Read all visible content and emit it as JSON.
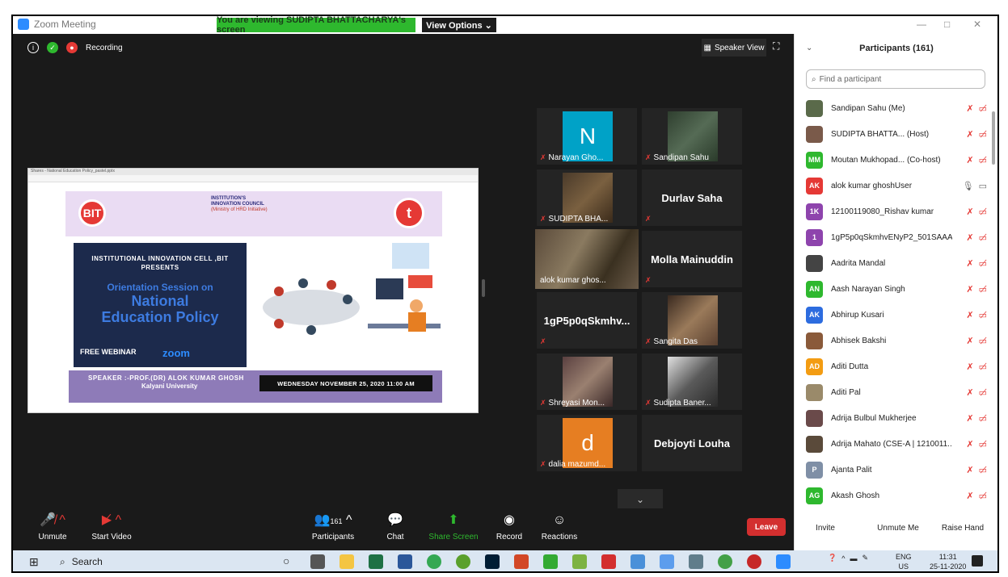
{
  "window": {
    "app_title": "Zoom Meeting",
    "viewing_banner": "You are viewing SUDIPTA BHATTACHARYA's screen",
    "view_options": "View Options ⌄",
    "minimize": "—",
    "maximize": "□",
    "close": "✕"
  },
  "meeting_top": {
    "recording_label": "Recording",
    "speaker_view_label": "Speaker View"
  },
  "shared_screen": {
    "doc_title": "Shares - National Education Policy_pastel.pptx",
    "logo_left": "BIT",
    "iic_text": "INSTITUTION'S INNOVATION COUNCIL",
    "iic_sub": "(Ministry of HRD Initiative)",
    "logo_right": "t",
    "line1": "INSTITUTIONAL INNOVATION CELL ,BIT",
    "line1b": "PRESENTS",
    "line2": "Orientation Session on",
    "line3": "National",
    "line4": "Education Policy",
    "webinar": "FREE WEBINAR",
    "zoom_logo": "zoom",
    "speaker": "SPEAKER :-PROF.(DR) ALOK KUMAR GHOSH",
    "affiliation": "Kalyani University",
    "date": "WEDNESDAY NOVEMBER 25, 2020 11:00 AM"
  },
  "tiles": [
    {
      "name": "Narayan Gho...",
      "avatar": "N",
      "color": "#00a2c7"
    },
    {
      "name": "Sandipan Sahu"
    },
    {
      "name": "SUDIPTA BHA..."
    },
    {
      "name": "Durlav Saha"
    },
    {
      "name": "alok kumar ghos..."
    },
    {
      "name": "Molla Mainuddin"
    },
    {
      "name": "1gP5p0qSkmhv..."
    },
    {
      "name": "Sangita Das"
    },
    {
      "name": "Shreyasi Mon..."
    },
    {
      "name": "Sudipta Baner..."
    },
    {
      "name": "dalia mazumd...",
      "avatar": "d",
      "color": "#e67e22"
    },
    {
      "name": "Debjoyti Louha"
    }
  ],
  "toolbar": {
    "unmute": "Unmute",
    "start_video": "Start Video",
    "participants": "Participants",
    "participants_count": "161",
    "chat": "Chat",
    "share_screen": "Share Screen",
    "record": "Record",
    "reactions": "Reactions",
    "leave": "Leave"
  },
  "panel": {
    "title": "Participants (161)",
    "search_placeholder": "Find a participant",
    "participants": [
      {
        "name": "Sandipan Sahu (Me)",
        "initials": "",
        "color": "#5a6a4a"
      },
      {
        "name": "SUDIPTA BHATTA... (Host)",
        "initials": "",
        "color": "#7a5a4a"
      },
      {
        "name": "Moutan Mukhopad... (Co-host)",
        "initials": "MM",
        "color": "#2eb82e"
      },
      {
        "name": "alok kumar ghoshUser",
        "initials": "AK",
        "color": "#e53935"
      },
      {
        "name": "12100119080_Rishav kumar",
        "initials": "1K",
        "color": "#8e44ad"
      },
      {
        "name": "1gP5p0qSkmhvENyP2_501SAAA...",
        "initials": "1",
        "color": "#8e44ad"
      },
      {
        "name": "Aadrita Mandal",
        "initials": "",
        "color": "#444"
      },
      {
        "name": "Aash Narayan Singh",
        "initials": "AN",
        "color": "#2eb82e"
      },
      {
        "name": "Abhirup Kusari",
        "initials": "AK",
        "color": "#2d6cdf"
      },
      {
        "name": "Abhisek Bakshi",
        "initials": "",
        "color": "#8a5a3a"
      },
      {
        "name": "Aditi Dutta",
        "initials": "AD",
        "color": "#f39c12"
      },
      {
        "name": "Aditi Pal",
        "initials": "",
        "color": "#9a8a6a"
      },
      {
        "name": "Adrija Bulbul Mukherjee",
        "initials": "",
        "color": "#6a4a4a"
      },
      {
        "name": "Adrija Mahato (CSE-A | 1210011...",
        "initials": "",
        "color": "#5a4a3a"
      },
      {
        "name": "Ajanta Palit",
        "initials": "P",
        "color": "#7f8fa6"
      },
      {
        "name": "Akash Ghosh",
        "initials": "AG",
        "color": "#2eb82e"
      }
    ],
    "invite": "Invite",
    "unmute_me": "Unmute Me",
    "raise_hand": "Raise Hand"
  },
  "taskbar": {
    "search": "Search",
    "lang1": "ENG",
    "lang2": "US",
    "time": "11:31",
    "date": "25-11-2020"
  }
}
